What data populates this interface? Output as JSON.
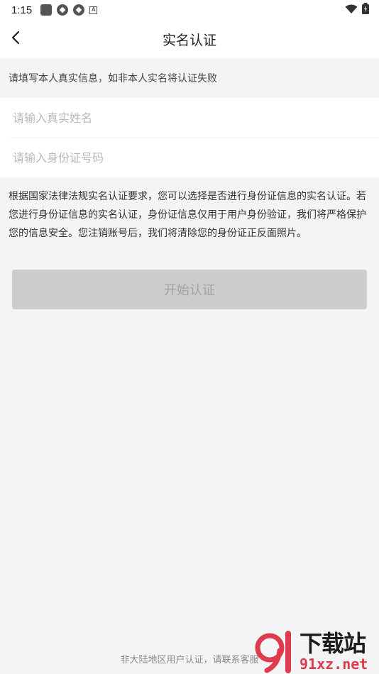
{
  "status_bar": {
    "time": "1:15",
    "notification_icons": [
      "app-square-icon",
      "aperture-icon",
      "aperture-icon",
      "a-box-icon"
    ],
    "right_icons": [
      "wifi-icon",
      "battery-icon"
    ]
  },
  "nav": {
    "back_icon": "chevron-left-icon",
    "title": "实名认证"
  },
  "notice": {
    "text": "请填写本人真实信息，如非本人实名将认证失败"
  },
  "form": {
    "name_placeholder": "请输入真实姓名",
    "name_value": "",
    "id_placeholder": "请输入身份证号码",
    "id_value": ""
  },
  "description": {
    "text": "根据国家法律法规实名认证要求，您可以选择是否进行身份证信息的实名认证。若您进行身份证信息的实名认证，身份证信息仅用于用户身份验证，我们将严格保护您的信息安全。您注销账号后，我们将清除您的身份证正反面照片。"
  },
  "start_button": {
    "label": "开始认证"
  },
  "footer": {
    "text": "非大陆地区用户认证，请联系客服"
  },
  "watermark": {
    "cn": "下载站",
    "en": "91xz.net"
  },
  "colors": {
    "page_bg": "#f3f4f6",
    "button_disabled": "#cccccc",
    "watermark_red": "#e03a4e"
  }
}
